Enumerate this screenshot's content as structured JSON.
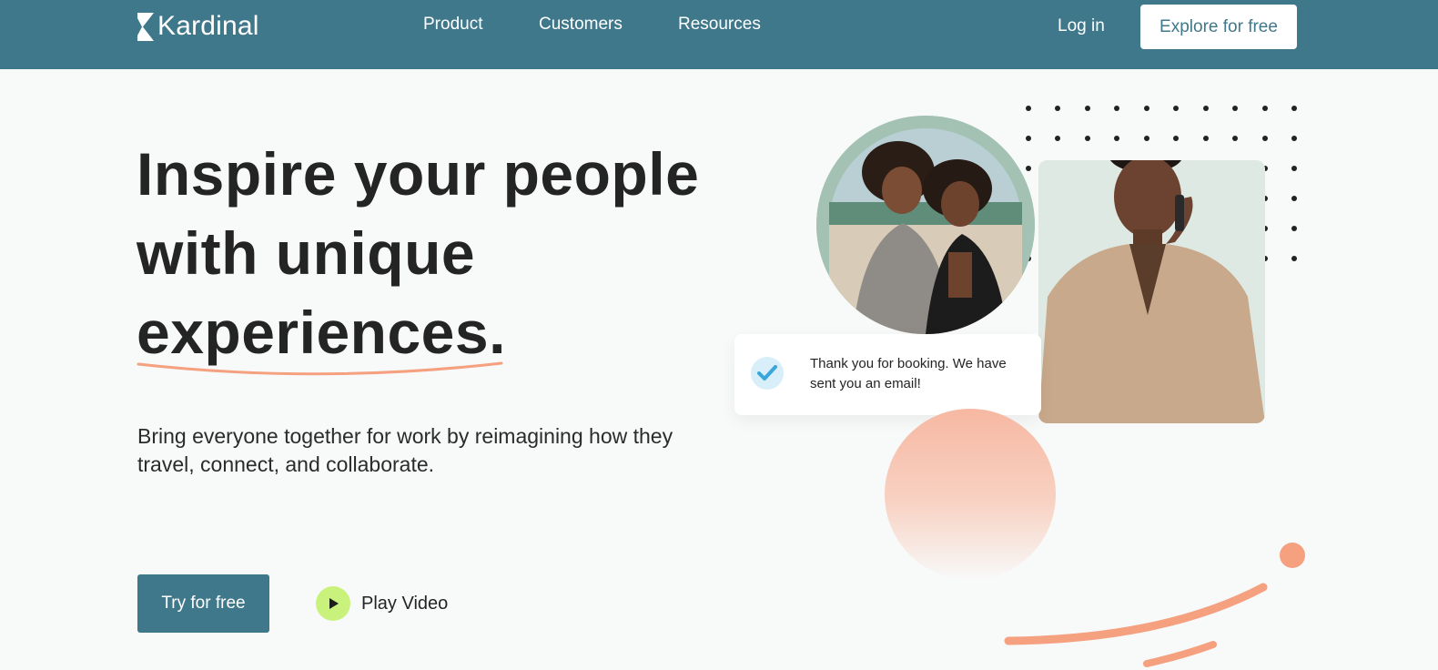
{
  "nav": {
    "brand": "Kardinal",
    "links": [
      "Product",
      "Customers",
      "Resources"
    ],
    "login_label": "Log in",
    "cta_label": "Explore for free"
  },
  "hero": {
    "headline_lines": [
      "Inspire your people",
      "with unique",
      "experiences."
    ],
    "subtitle": "Bring everyone together for work by reimagining how they travel, connect, and collaborate.",
    "primary_button": "Try for free",
    "video_label": "Play Video"
  },
  "toast": {
    "message": "Thank you for booking. We have sent you an email!"
  },
  "colors": {
    "nav_bg": "#40788b",
    "accent_peach": "#f5a07f",
    "play_green": "#c9f27d",
    "check_blue": "#3aa6d9"
  },
  "icons": [
    "kardinal-logo-icon",
    "play-icon",
    "checkmark-icon"
  ]
}
